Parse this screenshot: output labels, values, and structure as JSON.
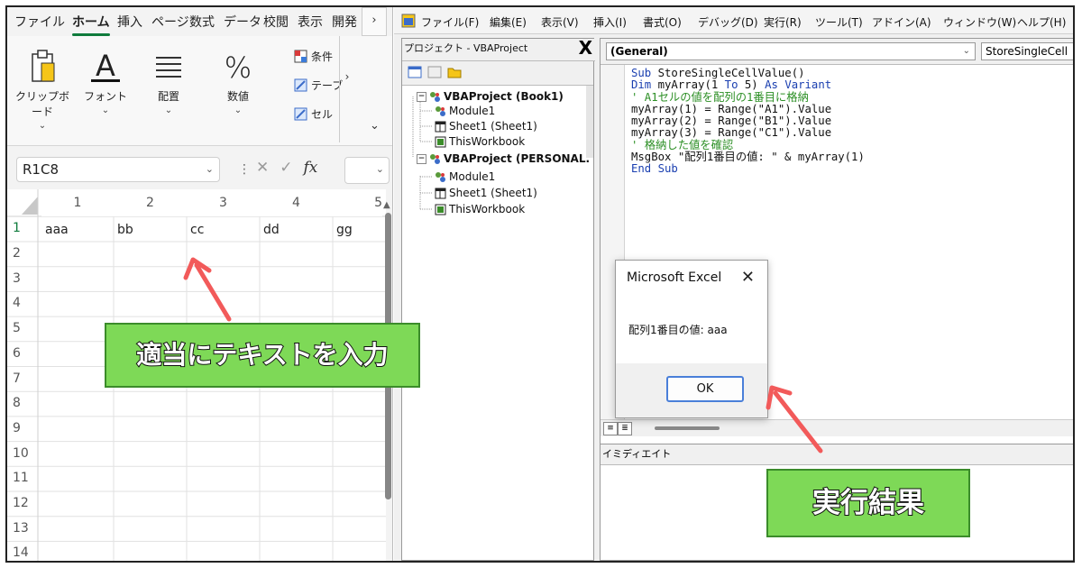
{
  "excel": {
    "tabs": [
      "ファイル",
      "ホーム",
      "挿入",
      "ページ",
      "数式",
      "データ",
      "校閲",
      "表示",
      "開発"
    ],
    "active_tab": "ホーム",
    "tab_more": "›",
    "ribbon_groups": [
      {
        "label": "クリップボード",
        "icon": "clipboard-icon"
      },
      {
        "label": "フォント",
        "icon": "font-icon"
      },
      {
        "label": "配置",
        "icon": "align-icon"
      },
      {
        "label": "数値",
        "icon": "percent-icon"
      }
    ],
    "ribbon_small": [
      "条件",
      "テーブ",
      "セル"
    ],
    "caret": "⌄",
    "next": "›",
    "collapse": "⌄",
    "name_box": "R1C8",
    "columns": [
      "1",
      "2",
      "3",
      "4",
      "5"
    ],
    "rows": [
      "1",
      "2",
      "3",
      "4",
      "5",
      "6",
      "7",
      "8",
      "9",
      "10",
      "11",
      "12",
      "13",
      "14"
    ],
    "row1_values": [
      "aaa",
      "bb",
      "cc",
      "dd",
      "gg"
    ]
  },
  "vbe": {
    "menu": [
      "ファイル(F)",
      "編集(E)",
      "表示(V)",
      "挿入(I)",
      "書式(O)",
      "デバッグ(D)",
      "実行(R)",
      "ツール(T)",
      "アドイン(A)",
      "ウィンドウ(W)",
      "ヘルプ(H)"
    ],
    "project_title": "プロジェクト - VBAProject",
    "project_close": "X",
    "tree": {
      "book1": "VBAProject (Book1)",
      "book1_module": "Module1",
      "book1_sheet": "Sheet1 (Sheet1)",
      "book1_wb": "ThisWorkbook",
      "personal": "VBAProject (PERSONAL.",
      "personal_module": "Module1",
      "personal_sheet": "Sheet1 (Sheet1)",
      "personal_wb": "ThisWorkbook"
    },
    "object_combo": "(General)",
    "proc_combo": "StoreSingleCell",
    "code": {
      "l1_kw": "Sub ",
      "l1": "StoreSingleCellValue()",
      "l2_kw": "Dim ",
      "l2a": "myArray(1 ",
      "l2_to": "To",
      "l2b": " 5) ",
      "l2_as": "As Variant",
      "l3": "' A1セルの値を配列の1番目に格納",
      "l4": "myArray(1) = Range(\"A1\").Value",
      "l5": "myArray(2) = Range(\"B1\").Value",
      "l6": "myArray(3) = Range(\"C1\").Value",
      "l7": "' 格納した値を確認",
      "l8": "MsgBox \"配列1番目の値: \" & myArray(1)",
      "l9": "End Sub"
    },
    "immediate_title": "イミディエイト"
  },
  "dialog": {
    "title": "Microsoft Excel",
    "close": "✕",
    "message": "配列1番目の値: aaa",
    "ok": "OK"
  },
  "annotations": {
    "left": "適当にテキストを入力",
    "right": "実行結果"
  },
  "colors": {
    "annotation_fill": "#7ed957",
    "arrow": "#f25a5a",
    "keyword": "#1a3fb0",
    "comment": "#2c8f25"
  }
}
